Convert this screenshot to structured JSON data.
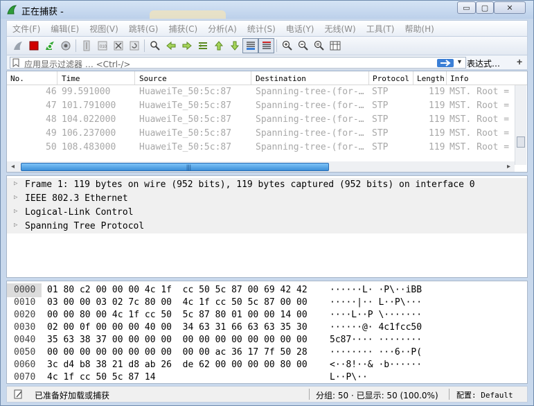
{
  "window": {
    "title": "正在捕获 -",
    "min_glyph": "▭",
    "max_glyph": "▢",
    "close_glyph": "✕"
  },
  "menu": [
    "文件(F)",
    "编辑(E)",
    "视图(V)",
    "跳转(G)",
    "捕获(C)",
    "分析(A)",
    "统计(S)",
    "电话(Y)",
    "无线(W)",
    "工具(T)",
    "帮助(H)"
  ],
  "toolbar": {
    "icons": [
      "shark-fin-start-icon",
      "stop-capture-icon",
      "restart-capture-icon",
      "capture-options-icon",
      "open-file-icon",
      "save-file-icon",
      "close-file-icon",
      "reload-file-icon",
      "find-packet-icon",
      "go-back-icon",
      "go-forward-icon",
      "go-to-packet-icon",
      "go-first-icon",
      "go-last-icon",
      "autoscroll-icon",
      "colorize-icon",
      "zoom-in-icon",
      "zoom-out-icon",
      "zoom-normal-icon",
      "resize-columns-icon"
    ]
  },
  "filter": {
    "placeholder": "应用显示过滤器 … <Ctrl-/>",
    "expression_button": "表达式…",
    "add_button": "+"
  },
  "packet_list": {
    "columns": [
      "No.",
      "Time",
      "Source",
      "Destination",
      "Protocol",
      "Length",
      "Info"
    ],
    "rows": [
      {
        "no": "46",
        "time": "99.591000",
        "source": "HuaweiTe_50:5c:87",
        "destination": "Spanning-tree-(for-…",
        "protocol": "STP",
        "length": "119",
        "info": "MST. Root ="
      },
      {
        "no": "47",
        "time": "101.791000",
        "source": "HuaweiTe_50:5c:87",
        "destination": "Spanning-tree-(for-…",
        "protocol": "STP",
        "length": "119",
        "info": "MST. Root ="
      },
      {
        "no": "48",
        "time": "104.022000",
        "source": "HuaweiTe_50:5c:87",
        "destination": "Spanning-tree-(for-…",
        "protocol": "STP",
        "length": "119",
        "info": "MST. Root ="
      },
      {
        "no": "49",
        "time": "106.237000",
        "source": "HuaweiTe_50:5c:87",
        "destination": "Spanning-tree-(for-…",
        "protocol": "STP",
        "length": "119",
        "info": "MST. Root ="
      },
      {
        "no": "50",
        "time": "108.483000",
        "source": "HuaweiTe_50:5c:87",
        "destination": "Spanning-tree-(for-…",
        "protocol": "STP",
        "length": "119",
        "info": "MST. Root ="
      }
    ],
    "hscroll_grip": "|||"
  },
  "details": [
    "Frame 1: 119 bytes on wire (952 bits), 119 bytes captured (952 bits) on interface 0",
    "IEEE 802.3 Ethernet",
    "Logical-Link Control",
    "Spanning Tree Protocol"
  ],
  "bytes": [
    {
      "offset": "0000",
      "hex": "01 80 c2 00 00 00 4c 1f  cc 50 5c 87 00 69 42 42",
      "ascii": "······L· ·P\\··iBB"
    },
    {
      "offset": "0010",
      "hex": "03 00 00 03 02 7c 80 00  4c 1f cc 50 5c 87 00 00",
      "ascii": "·····|·· L··P\\···"
    },
    {
      "offset": "0020",
      "hex": "00 00 80 00 4c 1f cc 50  5c 87 80 01 00 00 14 00",
      "ascii": "····L··P \\·······"
    },
    {
      "offset": "0030",
      "hex": "02 00 0f 00 00 00 40 00  34 63 31 66 63 63 35 30",
      "ascii": "······@· 4c1fcc50"
    },
    {
      "offset": "0040",
      "hex": "35 63 38 37 00 00 00 00  00 00 00 00 00 00 00 00",
      "ascii": "5c87···· ········"
    },
    {
      "offset": "0050",
      "hex": "00 00 00 00 00 00 00 00  00 00 ac 36 17 7f 50 28",
      "ascii": "········ ···6··P("
    },
    {
      "offset": "0060",
      "hex": "3c d4 b8 38 21 d8 ab 26  de 62 00 00 00 00 80 00",
      "ascii": "<··8!··& ·b······"
    },
    {
      "offset": "0070",
      "hex": "4c 1f cc 50 5c 87 14",
      "ascii": "L··P\\··"
    }
  ],
  "status": {
    "ready": "已准备好加载或捕获",
    "counts": "分组: 50 · 已显示: 50 (100.0%)",
    "profile": "配置: Default"
  },
  "colors": {
    "accent": "#3b7fd6",
    "scroll_thumb": "#3d8fd8",
    "stop_red": "#d00000",
    "restart_green": "#2ea52e"
  }
}
